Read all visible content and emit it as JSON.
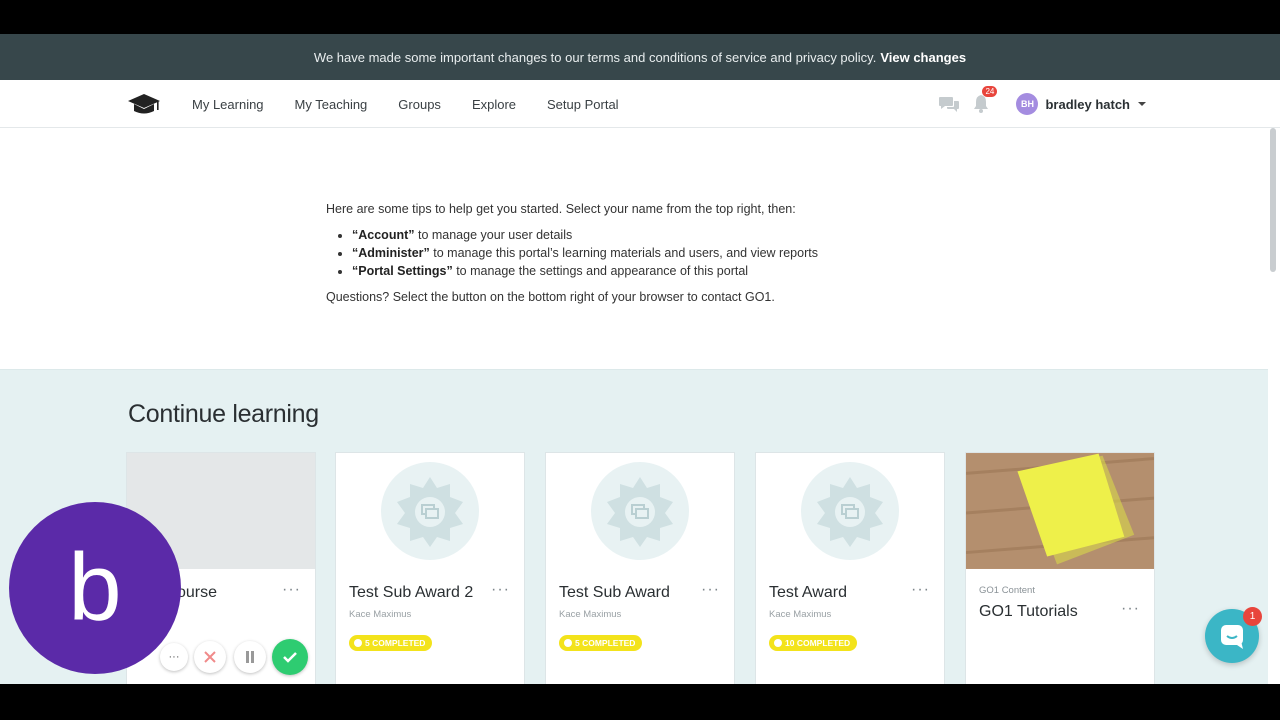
{
  "banner": {
    "message": "We have made some important changes to our terms and conditions of service and privacy policy.",
    "link": "View changes"
  },
  "nav": {
    "links": [
      "My Learning",
      "My Teaching",
      "Groups",
      "Explore",
      "Setup Portal"
    ],
    "notification_count": "24",
    "user_initials": "BH",
    "user_name": "bradley hatch"
  },
  "tips": {
    "intro": "Here are some tips to help get you started. Select your name from the top right, then:",
    "items": [
      {
        "strong": "“Account”",
        "text": " to manage your user details"
      },
      {
        "strong": "“Administer”",
        "text": " to manage this portal’s learning materials and users, and view reports"
      },
      {
        "strong": "“Portal Settings”",
        "text": " to manage the settings and appearance of this portal"
      }
    ],
    "outro": "Questions? Select the button on the bottom right of your browser to contact GO1."
  },
  "continue": {
    "heading": "Continue learning",
    "cards": [
      {
        "title": "ourse",
        "author": "",
        "status": ""
      },
      {
        "title": "Test Sub Award 2",
        "author": "Kace Maximus",
        "status": "5 COMPLETED"
      },
      {
        "title": "Test Sub Award",
        "author": "Kace Maximus",
        "status": "5 COMPLETED"
      },
      {
        "title": "Test Award",
        "author": "Kace Maximus",
        "status": "10 COMPLETED"
      },
      {
        "title": "GO1 Tutorials",
        "provider": "GO1 Content"
      }
    ],
    "more": "···"
  },
  "presenter": {
    "initial": "b"
  },
  "controls": {
    "more": "···"
  },
  "chat_widget": {
    "badge": "1"
  },
  "colors": {
    "banner": "#37474b",
    "section_bg": "#e5f1f2",
    "pill": "#f3e31b",
    "presenter": "#5b2aa8",
    "chat": "#3bb6c6",
    "badge": "#e8453c"
  }
}
